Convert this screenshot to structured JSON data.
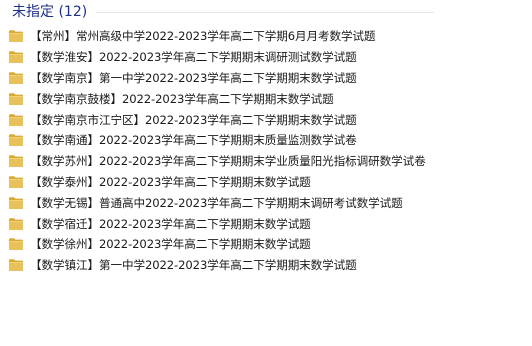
{
  "group": {
    "title": "未指定 (12)"
  },
  "colors": {
    "group_title": "#1e3287",
    "folder_body": "#e8c15a",
    "folder_tab": "#d9a934",
    "text": "#1a1a1a"
  },
  "files": [
    {
      "name": "【常州】常州高级中学2022-2023学年高二下学期6月月考数学试题",
      "icon": "folder-icon"
    },
    {
      "name": "【数学淮安】2022-2023学年高二下学期期末调研测试数学试题",
      "icon": "folder-icon"
    },
    {
      "name": "【数学南京】第一中学2022-2023学年高二下学期期末数学试题",
      "icon": "folder-icon"
    },
    {
      "name": "【数学南京鼓楼】2022-2023学年高二下学期期末数学试题",
      "icon": "folder-icon"
    },
    {
      "name": "【数学南京市江宁区】2022-2023学年高二下学期期末数学试题",
      "icon": "folder-icon"
    },
    {
      "name": "【数学南通】2022-2023学年高二下学期期末质量监测数学试卷",
      "icon": "folder-icon"
    },
    {
      "name": "【数学苏州】2022-2023学年高二下学期期末学业质量阳光指标调研数学试卷",
      "icon": "folder-icon"
    },
    {
      "name": "【数学泰州】2022-2023学年高二下学期期末数学试题",
      "icon": "folder-icon"
    },
    {
      "name": "【数学无锡】普通高中2022-2023学年高二下学期期末调研考试数学试题",
      "icon": "folder-icon"
    },
    {
      "name": "【数学宿迁】2022-2023学年高二下学期期末数学试题",
      "icon": "folder-icon"
    },
    {
      "name": "【数学徐州】2022-2023学年高二下学期期末数学试题",
      "icon": "folder-icon"
    },
    {
      "name": "【数学镇江】第一中学2022-2023学年高二下学期期末数学试题",
      "icon": "folder-icon"
    }
  ]
}
